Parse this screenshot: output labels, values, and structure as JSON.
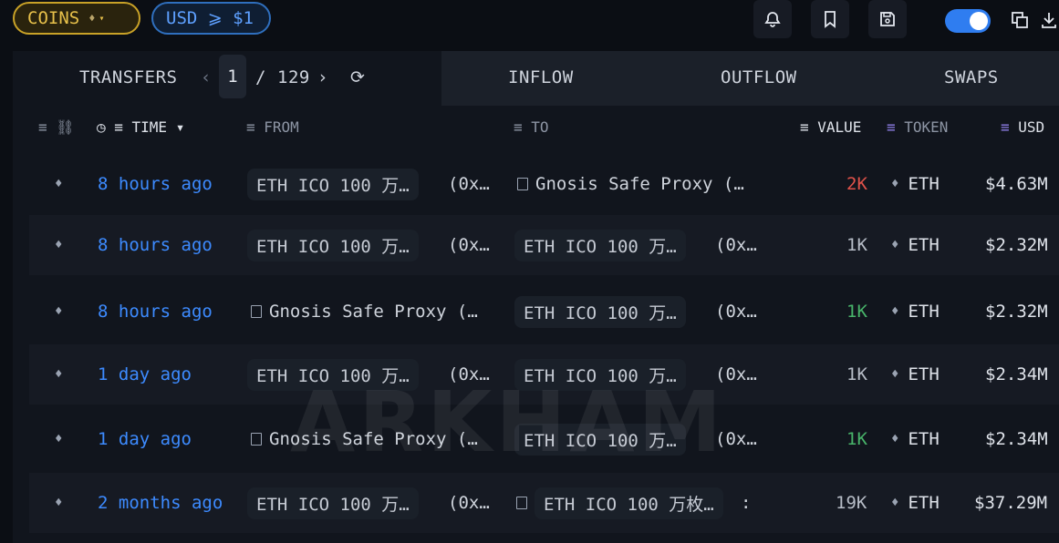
{
  "topbar": {
    "coins_label": "COINS",
    "usd_filter_label": "USD ⩾ $1",
    "toggle_on": true,
    "accent_color": "#2f7df0"
  },
  "tabs": {
    "transfers": "TRANSFERS",
    "page_current": "1",
    "page_sep": "/",
    "page_total": "129",
    "inflow": "INFLOW",
    "outflow": "OUTFLOW",
    "swaps": "SWAPS"
  },
  "columns": {
    "time": "TIME",
    "from": "FROM",
    "to": "TO",
    "value": "VALUE",
    "token": "TOKEN",
    "usd": "USD"
  },
  "rows": [
    {
      "time": "8 hours ago",
      "from": "ETH ICO 100 万…",
      "from_addr": "(0x…",
      "to": "Gnosis Safe Proxy (…",
      "to_addr": "",
      "value": "2K",
      "value_color": "red",
      "token": "ETH",
      "usd": "$4.63M"
    },
    {
      "time": "8 hours ago",
      "from": "ETH ICO 100 万…",
      "from_addr": "(0x…",
      "to": "ETH ICO 100 万…",
      "to_addr": "(0x…",
      "value": "1K",
      "value_color": "plain",
      "token": "ETH",
      "usd": "$2.32M"
    },
    {
      "time": "8 hours ago",
      "from": "Gnosis Safe Proxy (…",
      "from_addr": "",
      "to": "ETH ICO 100 万…",
      "to_addr": "(0x…",
      "value": "1K",
      "value_color": "green",
      "token": "ETH",
      "usd": "$2.32M"
    },
    {
      "time": "1 day ago",
      "from": "ETH ICO 100 万…",
      "from_addr": "(0x…",
      "to": "ETH ICO 100 万…",
      "to_addr": "(0x…",
      "value": "1K",
      "value_color": "plain",
      "token": "ETH",
      "usd": "$2.34M"
    },
    {
      "time": "1 day ago",
      "from": "Gnosis Safe Proxy (…",
      "from_addr": "",
      "to": "ETH ICO 100 万…",
      "to_addr": "(0x…",
      "value": "1K",
      "value_color": "green",
      "token": "ETH",
      "usd": "$2.34M"
    },
    {
      "time": "2 months ago",
      "from": "ETH ICO 100 万…",
      "from_addr": "(0x…",
      "to": "ETH ICO 100 万枚…",
      "to_addr": ":",
      "value": "19K",
      "value_color": "plain",
      "token": "ETH",
      "usd": "$37.29M"
    }
  ],
  "watermark": "ARKHAM"
}
